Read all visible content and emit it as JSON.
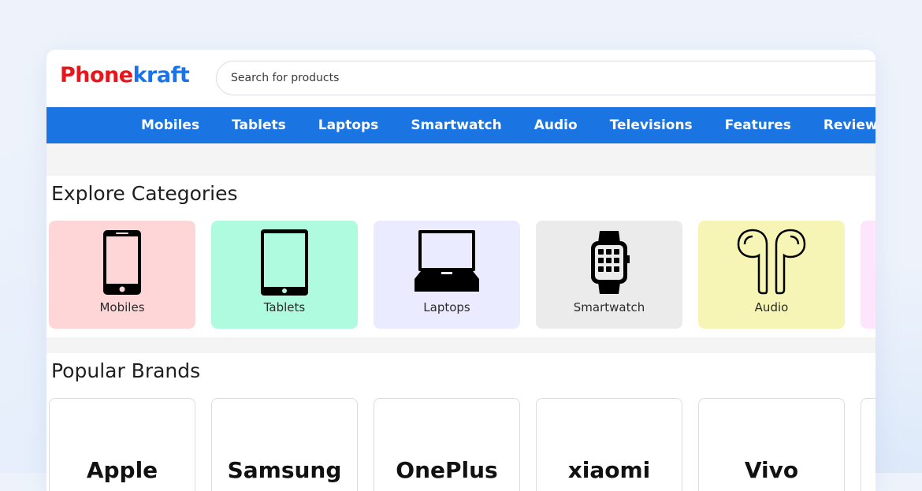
{
  "brand": {
    "logo_part1": "Phone",
    "logo_part2": "kraft",
    "logo_color1": "#e8151d",
    "logo_color2": "#1a73e8"
  },
  "search": {
    "placeholder": "Search for products"
  },
  "nav": {
    "items": [
      "Mobiles",
      "Tablets",
      "Laptops",
      "Smartwatch",
      "Audio",
      "Televisions",
      "Features",
      "Reviews"
    ],
    "color": "#1a74e2"
  },
  "categories": {
    "title": "Explore Categories",
    "items": [
      {
        "label": "Mobiles",
        "icon": "smartphone-icon",
        "bg": "#ffd6d8"
      },
      {
        "label": "Tablets",
        "icon": "tablet-icon",
        "bg": "#aefbe0"
      },
      {
        "label": "Laptops",
        "icon": "laptop-icon",
        "bg": "#ebebff"
      },
      {
        "label": "Smartwatch",
        "icon": "smartwatch-icon",
        "bg": "#ebebeb"
      },
      {
        "label": "Audio",
        "icon": "earbuds-icon",
        "bg": "#f6f5b6"
      },
      {
        "label": "",
        "icon": "",
        "bg": "#fde6fb"
      }
    ]
  },
  "brands": {
    "title": "Popular Brands",
    "items": [
      "Apple",
      "Samsung",
      "OnePlus",
      "xiaomi",
      "Vivo",
      ""
    ]
  }
}
